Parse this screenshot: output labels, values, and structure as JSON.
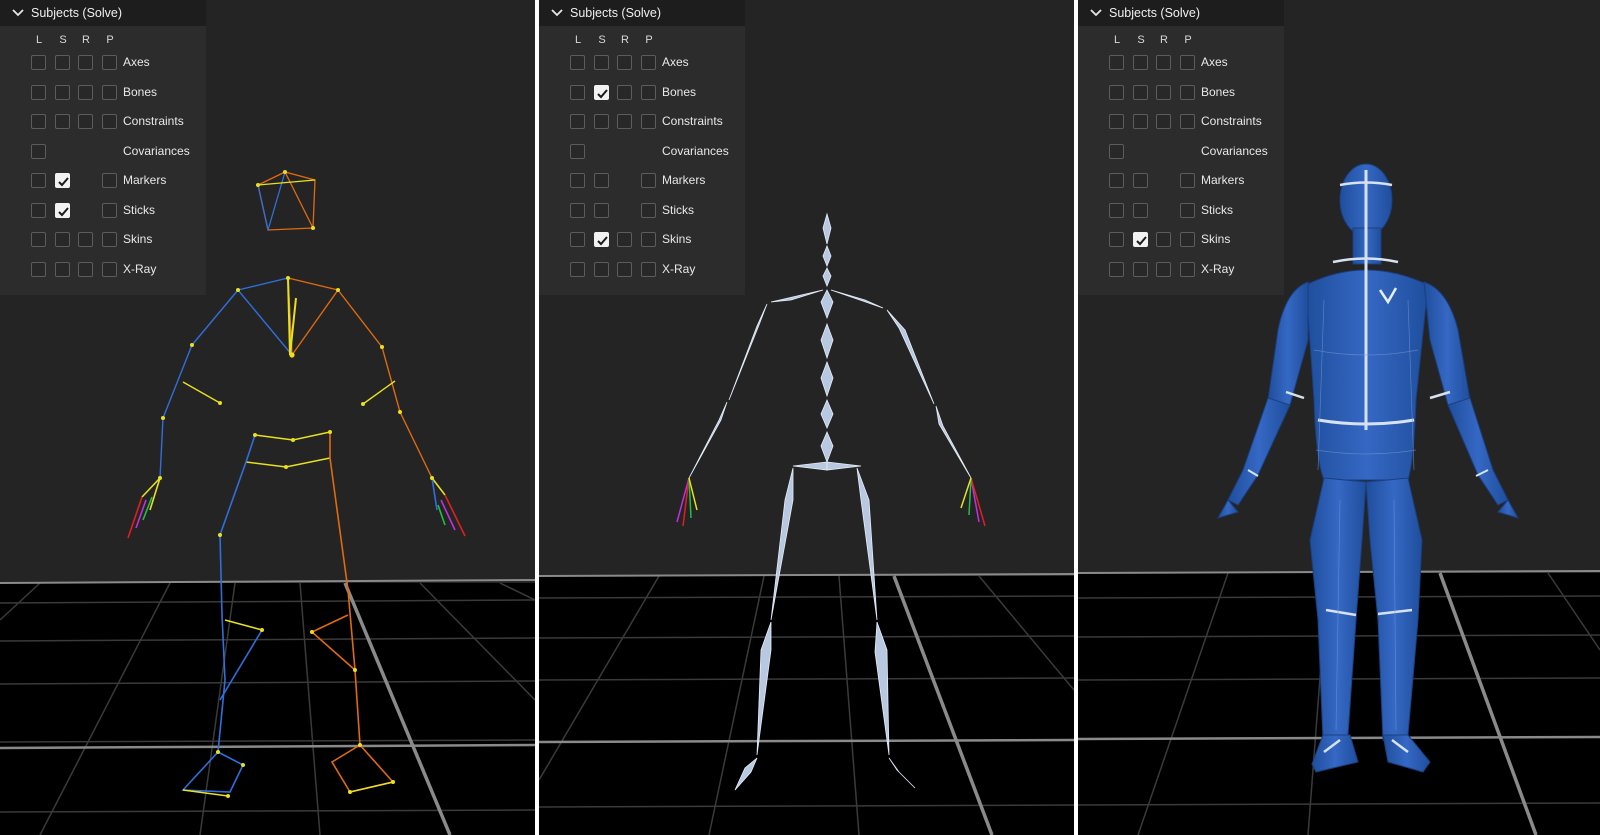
{
  "viewports": [
    {
      "id": "markers-sticks",
      "panel": {
        "title": "Subjects (Solve)",
        "columns": [
          "L",
          "S",
          "R",
          "P"
        ],
        "rows": [
          {
            "label": "Axes",
            "checks": [
              false,
              false,
              false,
              false
            ]
          },
          {
            "label": "Bones",
            "checks": [
              false,
              false,
              false,
              false
            ]
          },
          {
            "label": "Constraints",
            "checks": [
              false,
              false,
              false,
              false
            ]
          },
          {
            "label": "Covariances",
            "checks": [
              false,
              null,
              null,
              null
            ]
          },
          {
            "label": "Markers",
            "checks": [
              false,
              true,
              null,
              false
            ]
          },
          {
            "label": "Sticks",
            "checks": [
              false,
              true,
              null,
              false
            ]
          },
          {
            "label": "Skins",
            "checks": [
              false,
              false,
              false,
              false
            ]
          },
          {
            "label": "X-Ray",
            "checks": [
              false,
              false,
              false,
              false
            ]
          }
        ]
      }
    },
    {
      "id": "bones",
      "panel": {
        "title": "Subjects (Solve)",
        "columns": [
          "L",
          "S",
          "R",
          "P"
        ],
        "rows": [
          {
            "label": "Axes",
            "checks": [
              false,
              false,
              false,
              false
            ]
          },
          {
            "label": "Bones",
            "checks": [
              false,
              true,
              false,
              false
            ]
          },
          {
            "label": "Constraints",
            "checks": [
              false,
              false,
              false,
              false
            ]
          },
          {
            "label": "Covariances",
            "checks": [
              false,
              null,
              null,
              null
            ]
          },
          {
            "label": "Markers",
            "checks": [
              false,
              false,
              null,
              false
            ]
          },
          {
            "label": "Sticks",
            "checks": [
              false,
              false,
              null,
              false
            ]
          },
          {
            "label": "Skins",
            "checks": [
              false,
              true,
              false,
              false
            ]
          },
          {
            "label": "X-Ray",
            "checks": [
              false,
              false,
              false,
              false
            ]
          }
        ]
      }
    },
    {
      "id": "skin",
      "panel": {
        "title": "Subjects (Solve)",
        "columns": [
          "L",
          "S",
          "R",
          "P"
        ],
        "rows": [
          {
            "label": "Axes",
            "checks": [
              false,
              false,
              false,
              false
            ]
          },
          {
            "label": "Bones",
            "checks": [
              false,
              false,
              false,
              false
            ]
          },
          {
            "label": "Constraints",
            "checks": [
              false,
              false,
              false,
              false
            ]
          },
          {
            "label": "Covariances",
            "checks": [
              false,
              null,
              null,
              null
            ]
          },
          {
            "label": "Markers",
            "checks": [
              false,
              false,
              null,
              false
            ]
          },
          {
            "label": "Sticks",
            "checks": [
              false,
              false,
              null,
              false
            ]
          },
          {
            "label": "Skins",
            "checks": [
              false,
              true,
              false,
              false
            ]
          },
          {
            "label": "X-Ray",
            "checks": [
              false,
              false,
              false,
              false
            ]
          }
        ]
      }
    }
  ],
  "colors": {
    "viewport_bg": "#242424",
    "floor": "#000000",
    "grid": "#3a3a3a",
    "grid_axis": "#8a8a8a",
    "left_side": "#2f6fdc",
    "right_side": "#e06a10",
    "center": "#e8e020",
    "bone": "#b8c8e0",
    "skin": "#2b5fb8",
    "skin_seam": "#d6e2f0"
  }
}
